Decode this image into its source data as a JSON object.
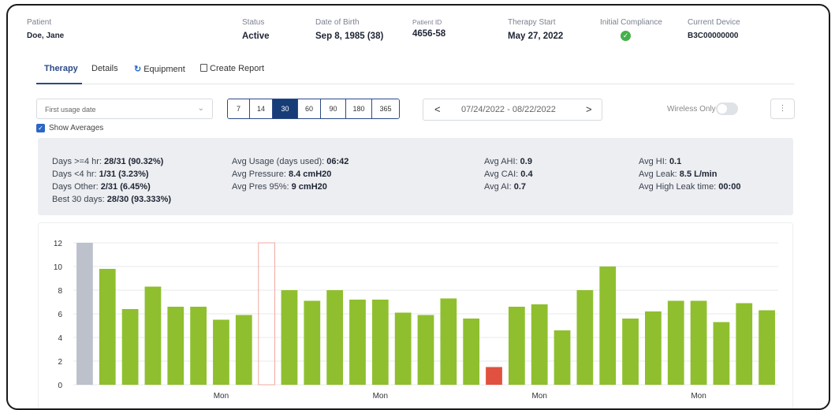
{
  "header": {
    "patient_label": "Patient",
    "patient_value": "Doe, Jane",
    "status_label": "Status",
    "status_value": "Active",
    "dob_label": "Date of Birth",
    "dob_value": "Sep 8, 1985 (38)",
    "pid_label": "Patient ID",
    "pid_value": "4656-58",
    "therapy_label": "Therapy Start",
    "therapy_value": "May 27, 2022",
    "compliance_label": "Initial Compliance",
    "compliance_icon": "check-circle-icon",
    "device_label": "Current Device",
    "device_value": "B3C00000000"
  },
  "tabs": [
    {
      "label": "Therapy",
      "active": true
    },
    {
      "label": "Details"
    },
    {
      "label": "Equipment",
      "icon": "refresh-icon"
    },
    {
      "label": "Create Report",
      "icon": "report-icon"
    }
  ],
  "controls": {
    "usage_select": "First usage date",
    "ranges": [
      "7",
      "14",
      "30",
      "60",
      "90",
      "180",
      "365"
    ],
    "selected_range": "30",
    "prev": "<",
    "next": ">",
    "date_range": "07/24/2022 - 08/22/2022",
    "wireless_label": "Wireless Only",
    "more": "⋮",
    "show_averages": "Show Averages"
  },
  "stats": {
    "col1": [
      {
        "k": "Days >=4 hr: ",
        "v": "28/31 (90.32%)"
      },
      {
        "k": "Days <4 hr: ",
        "v": "1/31 (3.23%)"
      },
      {
        "k": "Days Other: ",
        "v": "2/31 (6.45%)"
      },
      {
        "k": "Best 30 days: ",
        "v": "28/30 (93.333%)"
      }
    ],
    "col2": [
      {
        "k": "Avg Usage (days used): ",
        "v": "06:42"
      },
      {
        "k": "Avg Pressure: ",
        "v": "8.4 cmH20"
      },
      {
        "k": "Avg Pres 95%: ",
        "v": "9 cmH20"
      }
    ],
    "col3": [
      {
        "k": "Avg AHI: ",
        "v": "0.9"
      },
      {
        "k": "Avg CAI: ",
        "v": "0.4"
      },
      {
        "k": "Avg AI: ",
        "v": "0.7"
      }
    ],
    "col4": [
      {
        "k": "Avg HI: ",
        "v": "0.1"
      },
      {
        "k": "Avg Leak: ",
        "v": "8.5 L/min"
      },
      {
        "k": "Avg High Leak time: ",
        "v": "00:00"
      }
    ]
  },
  "colors": {
    "good": "#8fbf2f",
    "low": "#e0523f",
    "gray": "#bcc1cc",
    "outline": "#f2aaa0",
    "accent": "#173d78"
  },
  "chart_data": {
    "type": "bar",
    "ylim": [
      0,
      12
    ],
    "yticks": [
      0,
      2,
      4,
      6,
      8,
      10,
      12
    ],
    "values": [
      12,
      9.8,
      6.4,
      8.3,
      6.6,
      6.6,
      5.5,
      5.9,
      12,
      8.0,
      7.1,
      8.0,
      7.2,
      7.2,
      6.1,
      5.9,
      7.3,
      5.6,
      1.5,
      6.6,
      6.8,
      4.6,
      8.0,
      10.0,
      5.6,
      6.2,
      7.1,
      7.1,
      5.3,
      6.9,
      6.3
    ],
    "status": [
      "other",
      "good",
      "good",
      "good",
      "good",
      "good",
      "good",
      "good",
      "other_outline",
      "good",
      "good",
      "good",
      "good",
      "good",
      "good",
      "good",
      "good",
      "good",
      "low",
      "good",
      "good",
      "good",
      "good",
      "good",
      "good",
      "good",
      "good",
      "good",
      "good",
      "good",
      "good"
    ],
    "xlabels": [
      {
        "index": 6,
        "text": "Mon"
      },
      {
        "index": 13,
        "text": "Mon"
      },
      {
        "index": 20,
        "text": "Mon"
      },
      {
        "index": 27,
        "text": "Mon"
      }
    ]
  }
}
